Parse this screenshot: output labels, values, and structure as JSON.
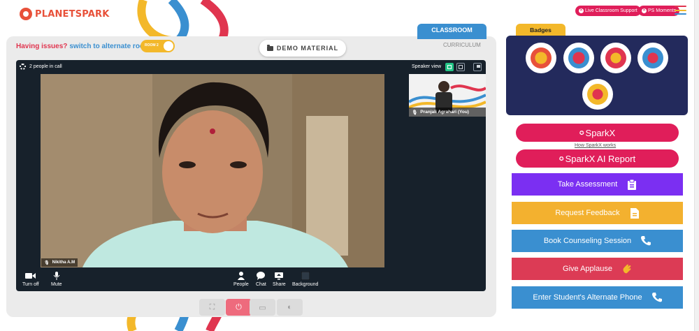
{
  "header": {
    "logo_text": "PLANETSPARK",
    "live_support_label": "Live Classroom Support",
    "ps_moments_label": "PS Moments"
  },
  "classroom": {
    "tab_classroom": "CLASSROOM",
    "tab_curriculum": "CURRICULUM",
    "issues_text": "Having issues?",
    "switch_text": "switch to alternate room",
    "room_label": "ROOM 2",
    "demo_material_label": "DEMO MATERIAL"
  },
  "call": {
    "people_count": "2 people in call",
    "speaker_view_label": "Speaker view",
    "main_participant": "Nikitha A.M",
    "self_participant": "Pranjali Agrahari (You)",
    "controls": {
      "turn_off": "Turn off",
      "mute": "Mute",
      "people": "People",
      "chat": "Chat",
      "share": "Share",
      "background": "Background"
    }
  },
  "badges": {
    "title": "Badges",
    "items": [
      "trophy-badge",
      "hands-badge",
      "star-character-badge",
      "lock-badge",
      "glasses-badge"
    ]
  },
  "sparkx": {
    "sparkx_label": "SparkX",
    "how_link": "How SparkX works",
    "ai_report_label": "SparkX AI Report"
  },
  "actions": [
    {
      "label": "Take Assessment",
      "color": "#7b2ff2",
      "icon": "clipboard-icon"
    },
    {
      "label": "Request Feedback",
      "color": "#f3b12f",
      "icon": "document-icon"
    },
    {
      "label": "Book Counseling Session",
      "color": "#3a8fd0",
      "icon": "phone-icon"
    },
    {
      "label": "Give Applause",
      "color": "#dc3b55",
      "icon": "clap-icon"
    },
    {
      "label": "Enter Student's Alternate Phone",
      "color": "#3a8fd0",
      "icon": "phone-icon"
    }
  ],
  "colors": {
    "brand_pink": "#e01e5a",
    "classroom_blue": "#3a8fd0",
    "badges_navy": "#232a5c",
    "badges_yellow": "#f3b82a"
  }
}
